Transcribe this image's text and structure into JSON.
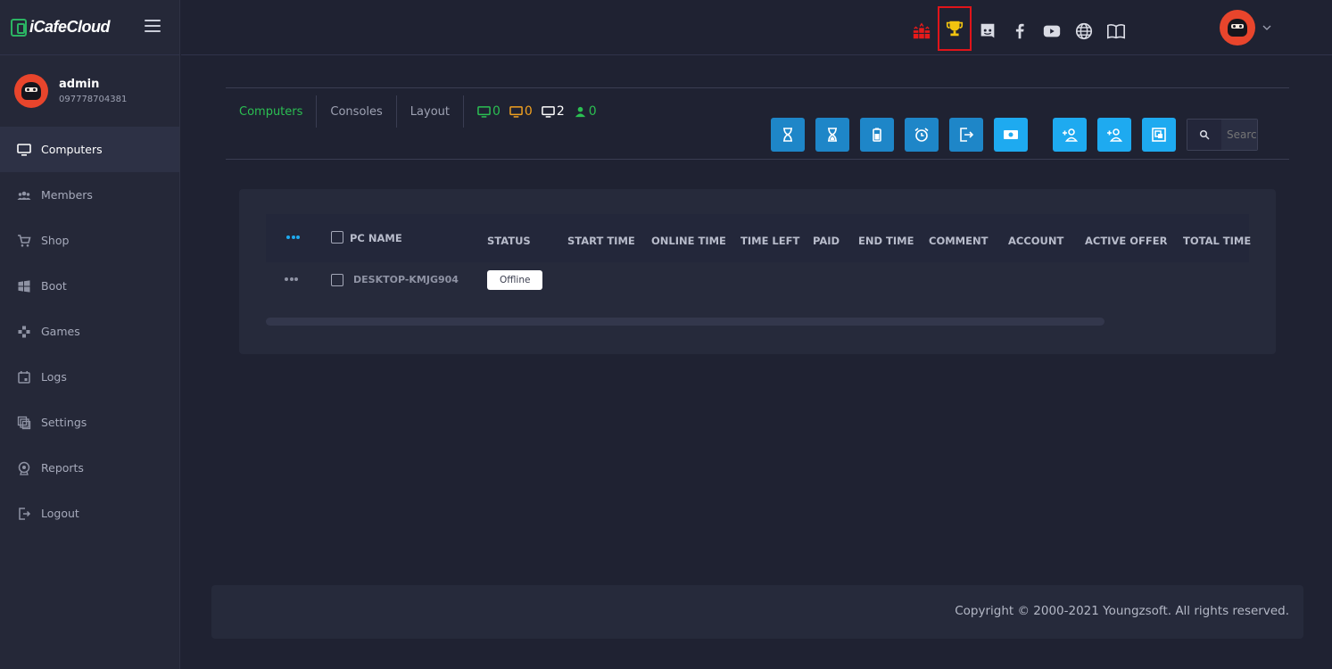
{
  "brand": {
    "name": "iCafeCloud"
  },
  "profile": {
    "name": "admin",
    "phone": "097778704381"
  },
  "sidebar": {
    "items": [
      {
        "label": "Computers",
        "icon": "monitor-icon",
        "active": true
      },
      {
        "label": "Members",
        "icon": "members-icon"
      },
      {
        "label": "Shop",
        "icon": "cart-icon"
      },
      {
        "label": "Boot",
        "icon": "windows-icon"
      },
      {
        "label": "Games",
        "icon": "gamepad-icon"
      },
      {
        "label": "Logs",
        "icon": "calendar-icon"
      },
      {
        "label": "Settings",
        "icon": "settings-icon"
      },
      {
        "label": "Reports",
        "icon": "reports-icon"
      },
      {
        "label": "Logout",
        "icon": "logout-icon"
      }
    ]
  },
  "topbar": {
    "icons": [
      "gifts-icon",
      "trophy-icon",
      "discord-icon",
      "facebook-icon",
      "youtube-icon",
      "globe-icon",
      "book-icon"
    ]
  },
  "tabs": [
    {
      "label": "Computers",
      "active": true
    },
    {
      "label": "Consoles"
    },
    {
      "label": "Layout"
    }
  ],
  "counts": {
    "available": "0",
    "in_use": "0",
    "total": "2",
    "members": "0"
  },
  "colors": {
    "green": "#2bbf52",
    "orange": "#f0a020",
    "white": "#ffffff",
    "accent_blue": "#1eaaf0",
    "dark_blue": "#1e86c8"
  },
  "actions": [
    "hourglass-icon",
    "hourglass-half-icon",
    "battery-icon",
    "alarm-icon",
    "exit-icon",
    "money-icon",
    "add-member-icon",
    "add-member-2-icon",
    "screenshot-icon"
  ],
  "search": {
    "placeholder": "Search"
  },
  "table": {
    "columns": [
      "PC NAME",
      "STATUS",
      "START TIME",
      "ONLINE TIME",
      "TIME LEFT",
      "PAID",
      "END TIME",
      "COMMENT",
      "ACCOUNT",
      "ACTIVE OFFER",
      "TOTAL TIME"
    ],
    "rows": [
      {
        "pc_name": "DESKTOP-KMJG904",
        "status": "Offline"
      }
    ]
  },
  "footer": {
    "copyright": "Copyright © 2000-2021 Youngzsoft. All rights reserved."
  }
}
